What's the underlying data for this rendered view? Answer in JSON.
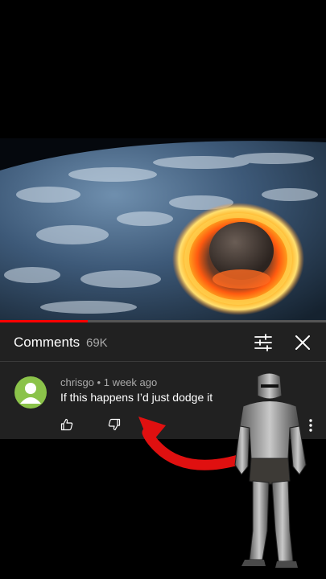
{
  "video": {
    "progress_fraction": 0.27
  },
  "comments": {
    "title": "Comments",
    "count": "69K"
  },
  "comment": {
    "author": "chrisgo",
    "separator": "•",
    "time": "1 week ago",
    "text": "If this happens I’d just dodge it"
  },
  "icons": {
    "filter": "filter-sliders-icon",
    "close": "close-icon",
    "like": "thumbs-up-icon",
    "dislike": "thumbs-down-icon",
    "more": "more-vertical-icon"
  },
  "colors": {
    "panel": "#212121",
    "accent_red": "#ff0000",
    "avatar": "#8bc34a",
    "arrow": "#e01010"
  }
}
